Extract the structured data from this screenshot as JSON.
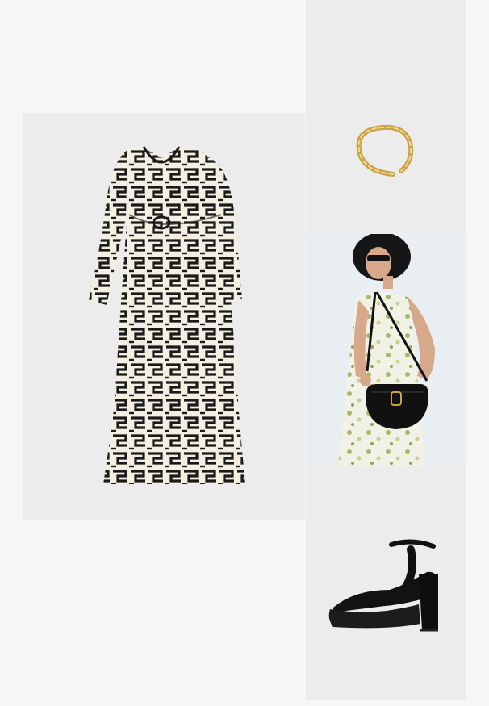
{
  "outfit": {
    "items": [
      {
        "kind": "dress",
        "pattern": "geometric",
        "colors": [
          "#1a1a1a",
          "#f4efe2"
        ]
      },
      {
        "kind": "ring",
        "color": "#c9a24a"
      },
      {
        "kind": "bag",
        "color": "#111111"
      },
      {
        "kind": "shoe",
        "color": "#121212"
      }
    ]
  }
}
